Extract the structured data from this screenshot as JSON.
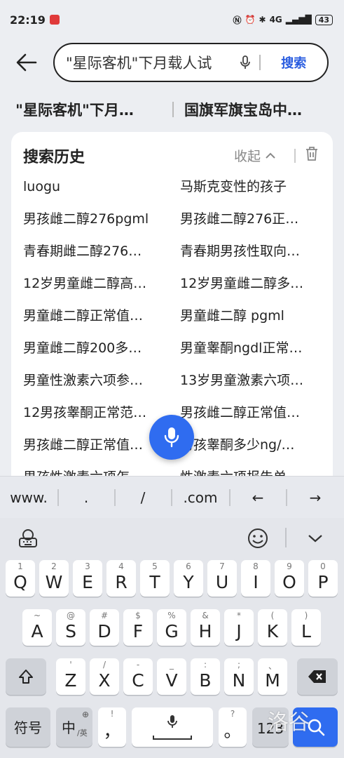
{
  "status": {
    "time": "22:19",
    "network": "4G",
    "battery": "43"
  },
  "search": {
    "query": "\"星际客机\"下月载人试",
    "button": "搜索"
  },
  "suggestions": [
    "\"星际客机\"下月…",
    "国旗军旗宝岛中…"
  ],
  "history": {
    "title": "搜索历史",
    "collapse": "收起",
    "items": [
      "luogu",
      "马斯克变性的孩子",
      "男孩雌二醇276pgml",
      "男孩雌二醇276正…",
      "青春期雌二醇276…",
      "青春期男孩性取向…",
      "12岁男童雌二醇高…",
      "12岁男童雌二醇多…",
      "男童雌二醇正常值…",
      "男童雌二醇 pgml",
      "男童雌二醇200多…",
      "男童睾酮ngdl正常…",
      "男童性激素六项参…",
      "13岁男童激素六项…",
      "12男孩睾酮正常范…",
      "男孩雌二醇正常值…",
      "男孩雌二醇正常值…",
      "男孩睾酮多少ng/…",
      "男孩性激素六项怎…",
      "性激素六项报告单…"
    ]
  },
  "quickbar": [
    "www.",
    ".",
    "/",
    ".com",
    "←",
    "→"
  ],
  "keyboard": {
    "row1": [
      {
        "hint": "1",
        "key": "Q"
      },
      {
        "hint": "2",
        "key": "W"
      },
      {
        "hint": "3",
        "key": "E"
      },
      {
        "hint": "4",
        "key": "R"
      },
      {
        "hint": "5",
        "key": "T"
      },
      {
        "hint": "6",
        "key": "Y"
      },
      {
        "hint": "7",
        "key": "U"
      },
      {
        "hint": "8",
        "key": "I"
      },
      {
        "hint": "9",
        "key": "O"
      },
      {
        "hint": "0",
        "key": "P"
      }
    ],
    "row2": [
      {
        "hint": "~",
        "key": "A"
      },
      {
        "hint": "@",
        "key": "S"
      },
      {
        "hint": "#",
        "key": "D"
      },
      {
        "hint": "$",
        "key": "F"
      },
      {
        "hint": "%",
        "key": "G"
      },
      {
        "hint": "&",
        "key": "H"
      },
      {
        "hint": "*",
        "key": "J"
      },
      {
        "hint": "(",
        "key": "K"
      },
      {
        "hint": ")",
        "key": "L"
      }
    ],
    "row3": [
      {
        "hint": "'",
        "key": "Z"
      },
      {
        "hint": "/",
        "key": "X"
      },
      {
        "hint": "-",
        "key": "C"
      },
      {
        "hint": "_",
        "key": "V"
      },
      {
        "hint": ":",
        "key": "B"
      },
      {
        "hint": ";",
        "key": "N"
      },
      {
        "hint": "、",
        "key": "M"
      }
    ],
    "symbols": "符号",
    "lang_main": "中",
    "lang_sub": "/英",
    "comma_hint": "!",
    "comma": "，",
    "period_hint": "?",
    "period": "。",
    "num": "123"
  },
  "watermark": "洛谷",
  "colors": {
    "accent": "#2f6cf0"
  }
}
